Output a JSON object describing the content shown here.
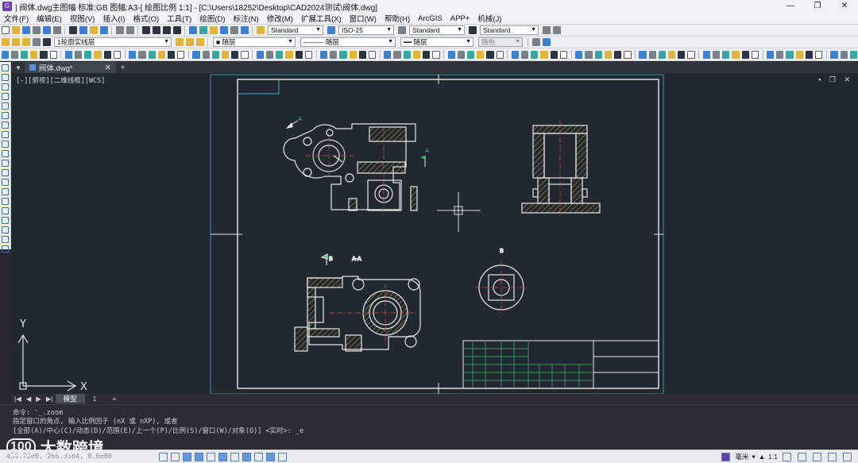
{
  "window": {
    "title": "| 阀体.dwg主图幅  标准:GB 图幅:A3-[ 绘图比例 1:1] - [C:\\Users\\18252\\Desktop\\CAD2024测试\\阀体.dwg]",
    "controls": [
      "—",
      "❐",
      "✕"
    ]
  },
  "menu": [
    "文件(F)",
    "编辑(E)",
    "视图(V)",
    "插入(I)",
    "格式(O)",
    "工具(T)",
    "绘图(D)",
    "标注(N)",
    "修改(M)",
    "扩展工具(X)",
    "窗口(W)",
    "帮助(H)",
    "ArcGIS",
    "APP+",
    "机械(J)"
  ],
  "toolbar1": {
    "text_style": "Standard",
    "dim_style": "ISO-25",
    "table_style": "Standard",
    "multileader_style": "Standard"
  },
  "toolbar2": {
    "layer": "1轮廓实线层",
    "color": "随层",
    "linetype": "随层",
    "lineweight": "随层",
    "plotstyle": "随色"
  },
  "document_tab": {
    "name": "阀体.dwg*",
    "close": "✕",
    "add": "+"
  },
  "viewport": {
    "label": "[-][俯视][二维线框][WCS]",
    "controls": "▪ ❐ ✕",
    "ucs": {
      "x": "X",
      "y": "Y"
    },
    "annotations": {
      "section_a1": "A",
      "section_a2": "A",
      "section_b": "B",
      "view_aa": "A-A",
      "view_b": "B"
    }
  },
  "layout_tabs": {
    "nav": [
      "|◀",
      "◀",
      "▶",
      "▶|"
    ],
    "tabs": [
      "模型",
      "1"
    ],
    "add": "+"
  },
  "command": {
    "line1": "命令: '_.zoom",
    "line2": "指定窗口的角点, 输入比例因子 (nX 或 nXP), 或者",
    "line3": "[全部(A)/中心(C)/动态(D)/范围(E)/上一个(P)/比例(S)/窗口(W)/对象(O)] <实时>: _e"
  },
  "status": {
    "coords": "459.7200, 268.3384, 0.0000",
    "units": "毫米",
    "scale": "1:1"
  },
  "watermark": {
    "logo": "100",
    "text": "大数跨境"
  }
}
